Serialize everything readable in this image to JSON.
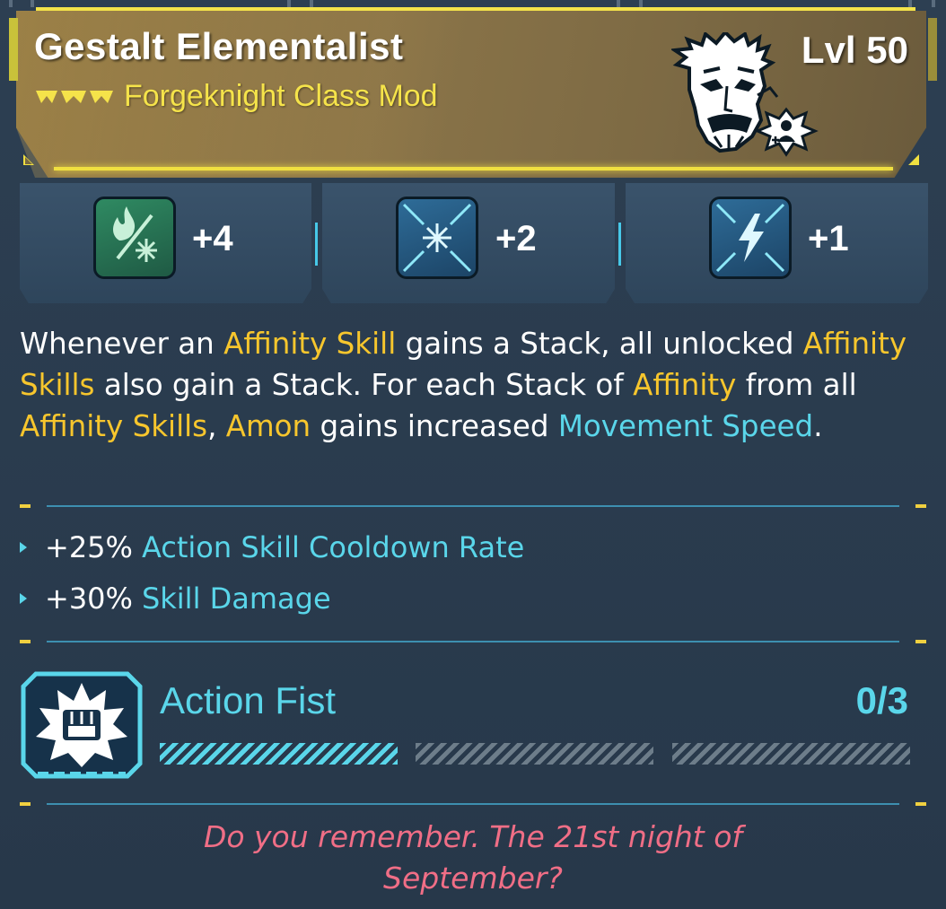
{
  "item": {
    "name": "Gestalt Elementalist",
    "type": "Forgeknight Class Mod",
    "level": "Lvl 50",
    "rarity_color": "#f5e34a",
    "portrait_icon": "bearded-character-portrait-icon",
    "class_badge_icon": "character-plus-badge-icon"
  },
  "skills": [
    {
      "icon": "fire-frost-affinity-icon",
      "value": "+4",
      "color": "#1f6a4c"
    },
    {
      "icon": "frost-snowflake-icon",
      "value": "+2",
      "color": "#1f5278"
    },
    {
      "icon": "lightning-bolt-icon",
      "value": "+1",
      "color": "#1f5278"
    }
  ],
  "description": {
    "segments": [
      {
        "text": "Whenever an ",
        "style": "plain"
      },
      {
        "text": "Affinity Skill",
        "style": "yellow"
      },
      {
        "text": " gains a Stack, all unlocked ",
        "style": "plain"
      },
      {
        "text": "Affinity Skills",
        "style": "yellow"
      },
      {
        "text": " also gain a Stack. For each Stack of ",
        "style": "plain"
      },
      {
        "text": "Affinity",
        "style": "yellow"
      },
      {
        "text": " from all ",
        "style": "plain"
      },
      {
        "text": "Affinity Skills",
        "style": "yellow"
      },
      {
        "text": ", ",
        "style": "plain"
      },
      {
        "text": "Amon",
        "style": "yellow"
      },
      {
        "text": " gains increased ",
        "style": "plain"
      },
      {
        "text": "Movement Speed",
        "style": "cyan"
      },
      {
        "text": ".",
        "style": "plain"
      }
    ]
  },
  "stats": [
    {
      "value": "+25%",
      "label": "Action Skill Cooldown Rate"
    },
    {
      "value": "+30%",
      "label": "Skill Damage"
    }
  ],
  "action_skill": {
    "name": "Action Fist",
    "count": "0/3",
    "icon": "fist-burst-icon",
    "progress_segments_total": 3,
    "progress_segments_highlighted": 1
  },
  "flavor_text": {
    "line1": "Do you remember. The 21st night of",
    "line2": "September?"
  },
  "colors": {
    "accent_yellow": "#f7c62d",
    "accent_cyan": "#5ad6ea",
    "flavor_pink": "#f06e86"
  }
}
